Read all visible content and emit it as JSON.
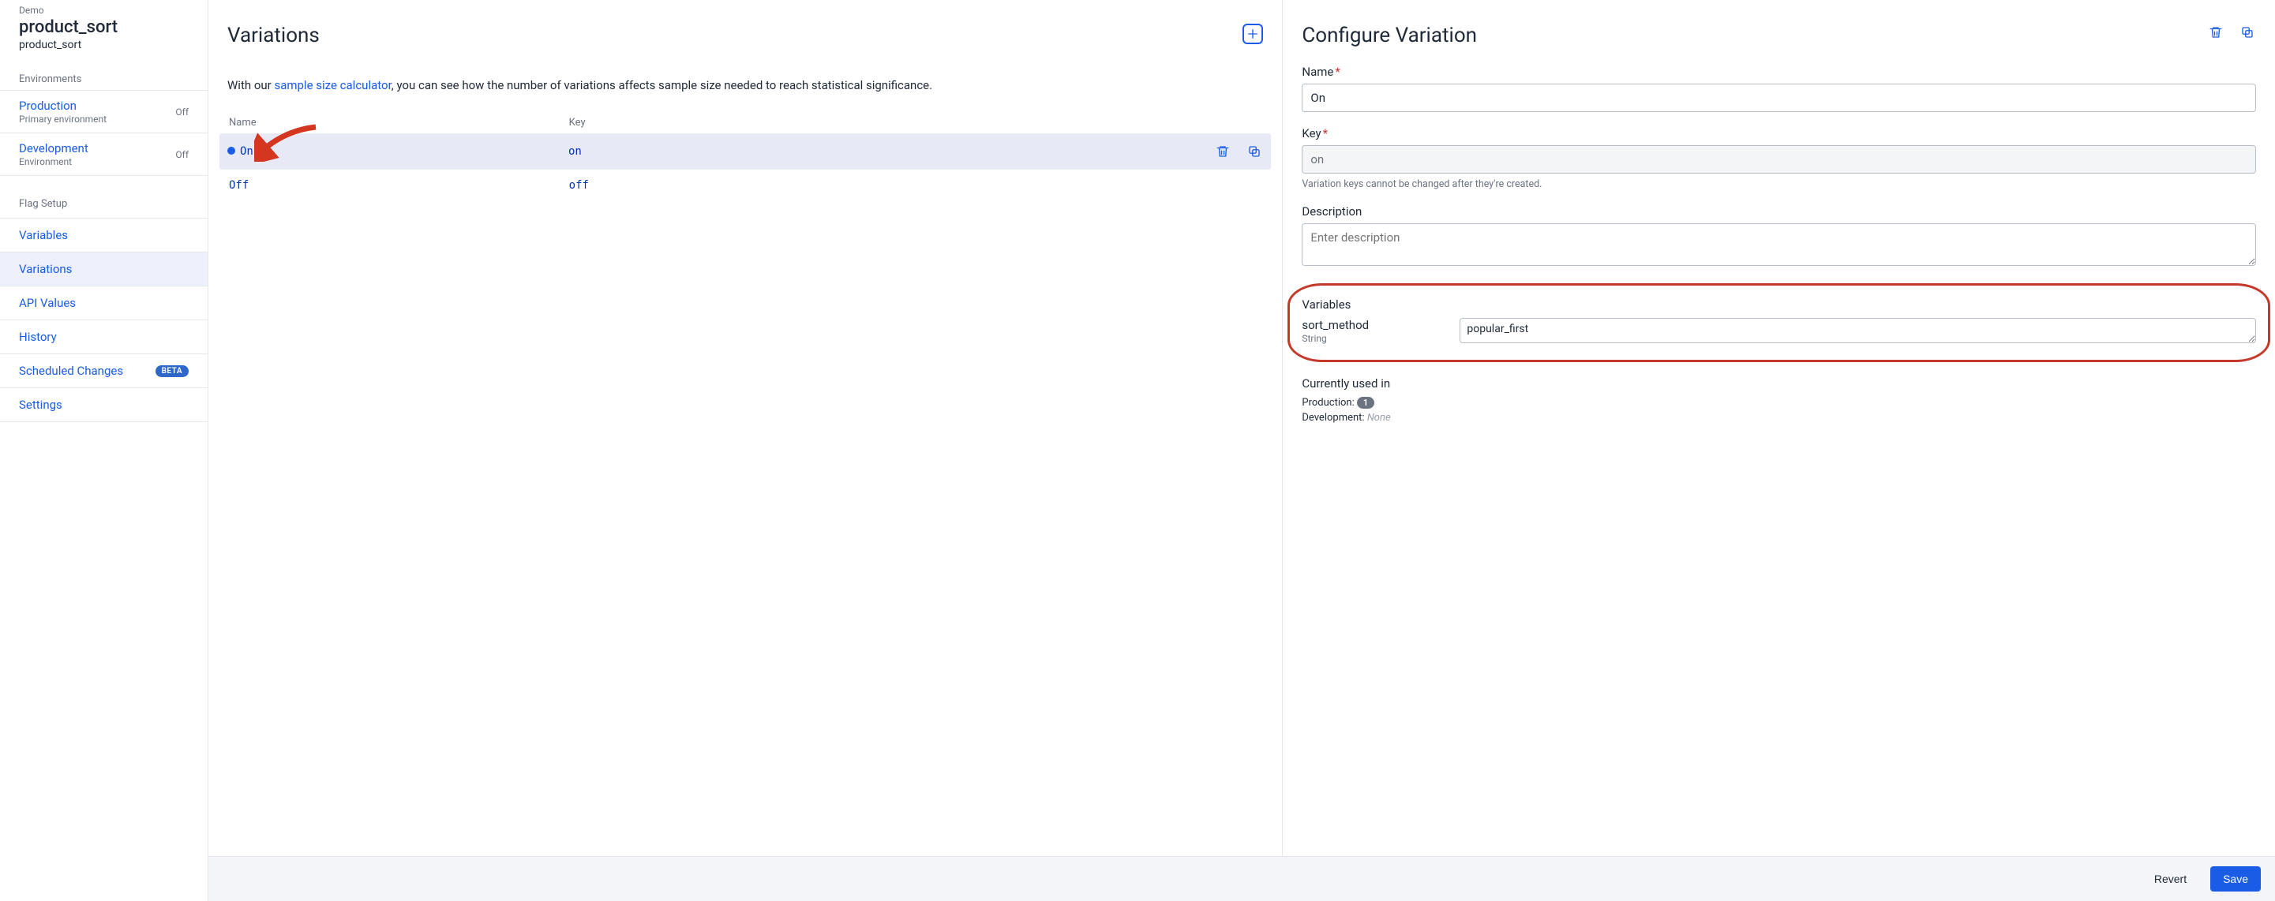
{
  "sidebar": {
    "breadcrumb_top": "Demo",
    "title": "product_sort",
    "subtitle": "product_sort",
    "environments_label": "Environments",
    "environments": [
      {
        "name": "Production",
        "sub": "Primary environment",
        "status": "Off"
      },
      {
        "name": "Development",
        "sub": "Environment",
        "status": "Off"
      }
    ],
    "flag_setup_label": "Flag Setup",
    "nav": [
      {
        "label": "Variables"
      },
      {
        "label": "Variations"
      },
      {
        "label": "API Values"
      },
      {
        "label": "History"
      },
      {
        "label": "Scheduled Changes",
        "badge": "BETA"
      },
      {
        "label": "Settings"
      }
    ],
    "active_nav": "Variations"
  },
  "variations_panel": {
    "title": "Variations",
    "desc_prefix": "With our ",
    "desc_link": "sample size calculator",
    "desc_suffix": ", you can see how the number of variations affects sample size needed to reach statistical significance.",
    "col_name": "Name",
    "col_key": "Key",
    "rows": [
      {
        "name": "On",
        "key": "on",
        "selected": true
      },
      {
        "name": "Off",
        "key": "off",
        "selected": false
      }
    ]
  },
  "configure_panel": {
    "title": "Configure Variation",
    "name_label": "Name",
    "name_value": "On",
    "key_label": "Key",
    "key_value": "on",
    "key_hint": "Variation keys cannot be changed after they're created.",
    "description_label": "Description",
    "description_placeholder": "Enter description",
    "description_value": "",
    "variables_label": "Variables",
    "variable_name": "sort_method",
    "variable_type": "String",
    "variable_value": "popular_first",
    "used_label": "Currently used in",
    "used_production_label": "Production:",
    "used_production_count": "1",
    "used_development_label": "Development:",
    "used_development_value": "None"
  },
  "footer": {
    "revert": "Revert",
    "save": "Save"
  }
}
